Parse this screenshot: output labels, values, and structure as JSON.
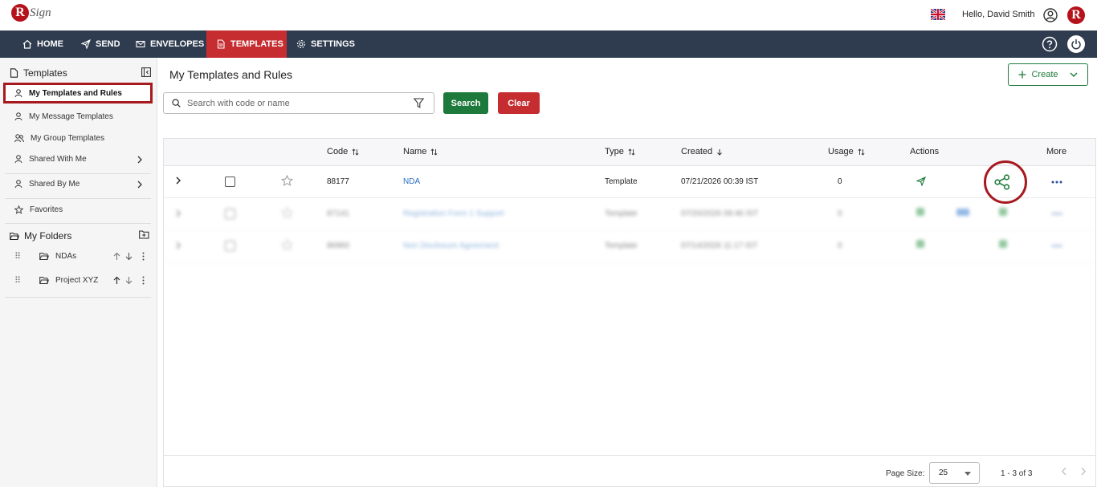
{
  "header": {
    "brand_letter": "R",
    "brand_word": "Sign",
    "greeting": "Hello, David Smith",
    "avatar_letter": "R"
  },
  "nav": [
    {
      "label": "HOME",
      "icon": "home-icon"
    },
    {
      "label": "SEND",
      "icon": "send-icon"
    },
    {
      "label": "ENVELOPES",
      "icon": "envelope-icon"
    },
    {
      "label": "TEMPLATES",
      "icon": "template-icon",
      "active": true
    },
    {
      "label": "SETTINGS",
      "icon": "gear-icon"
    }
  ],
  "sidebar": {
    "title": "Templates",
    "items": [
      {
        "label": "My Templates and Rules",
        "active": true
      },
      {
        "label": "My Message Templates"
      },
      {
        "label": "My Group Templates"
      },
      {
        "label": "Shared With Me"
      },
      {
        "label": "Shared By Me"
      },
      {
        "label": "Favorites"
      }
    ],
    "folders_title": "My Folders",
    "folders": [
      {
        "name": "NDAs"
      },
      {
        "name": "Project XYZ"
      }
    ]
  },
  "main": {
    "title": "My Templates and Rules",
    "create_label": "Create",
    "search_placeholder": "Search with code or name",
    "search_label": "Search",
    "clear_label": "Clear"
  },
  "table": {
    "columns": {
      "code": "Code",
      "name": "Name",
      "type": "Type",
      "created": "Created",
      "usage": "Usage",
      "actions": "Actions",
      "more": "More"
    },
    "rows": [
      {
        "code": "88177",
        "name": "NDA",
        "type": "Template",
        "created": "07/21/2026 00:39 IST",
        "usage": "0"
      },
      {
        "code": "87141",
        "name": "Registration Form 1 Support",
        "type": "Template",
        "created": "07/20/2026 09:46 IST",
        "usage": "0"
      },
      {
        "code": "86960",
        "name": "Non Disclosure Agreement",
        "type": "Template",
        "created": "07/14/2026 11:17 IST",
        "usage": "0"
      }
    ]
  },
  "pagination": {
    "page_size_label": "Page Size:",
    "page_size": "25",
    "range": "1 - 3 of 3"
  },
  "colors": {
    "nav_bg": "#2f3c4f",
    "active_red": "#c62d31",
    "green": "#1e7a3c",
    "link": "#2a6fc0",
    "highlight": "#a61a1f"
  }
}
